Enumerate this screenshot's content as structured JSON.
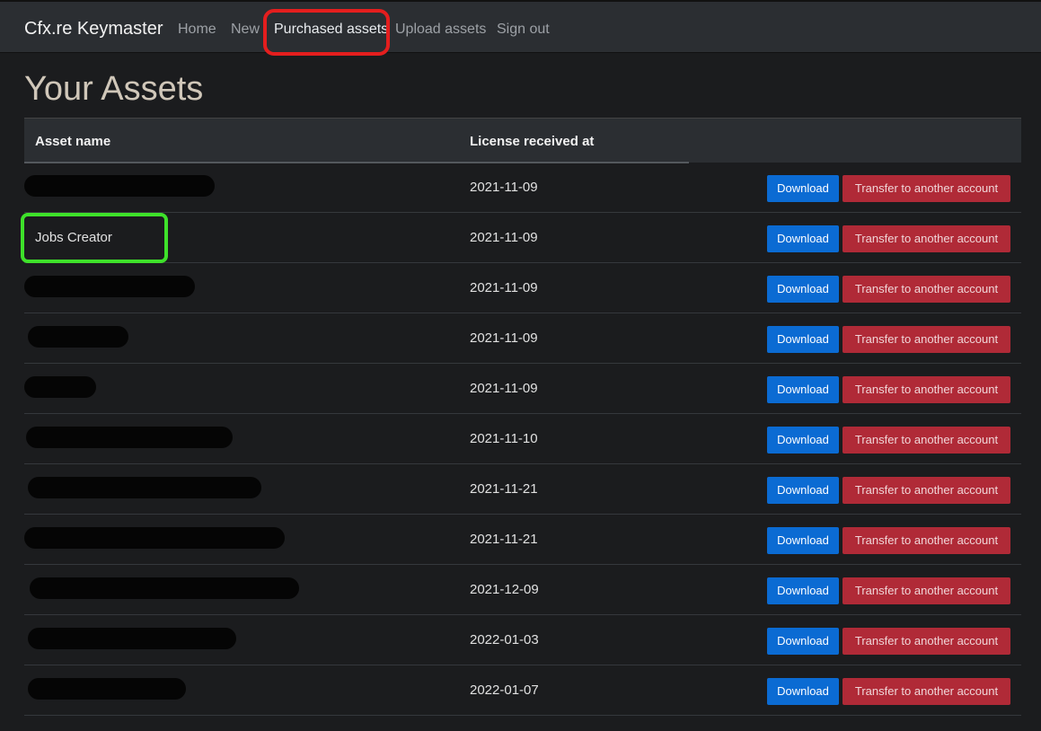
{
  "navbar": {
    "brand": "Cfx.re Keymaster",
    "links": [
      "Home",
      "New",
      "Purchased assets",
      "Upload assets",
      "Sign out"
    ]
  },
  "page": {
    "title": "Your Assets"
  },
  "table": {
    "headers": [
      "Asset name",
      "License received at"
    ],
    "download_label": "Download",
    "transfer_label": "Transfer to another account",
    "rows": [
      {
        "name": "",
        "redacted": true,
        "date": "2021-11-09"
      },
      {
        "name": "Jobs Creator",
        "redacted": false,
        "date": "2021-11-09"
      },
      {
        "name": "",
        "redacted": true,
        "date": "2021-11-09"
      },
      {
        "name": "",
        "redacted": true,
        "date": "2021-11-09"
      },
      {
        "name": "",
        "redacted": true,
        "date": "2021-11-09"
      },
      {
        "name": "",
        "redacted": true,
        "date": "2021-11-10"
      },
      {
        "name": "",
        "redacted": true,
        "date": "2021-11-21"
      },
      {
        "name": "",
        "redacted": true,
        "date": "2021-11-21"
      },
      {
        "name": "",
        "redacted": true,
        "date": "2021-12-09"
      },
      {
        "name": "",
        "redacted": true,
        "date": "2022-01-03"
      },
      {
        "name": "",
        "redacted": true,
        "date": "2022-01-07"
      }
    ]
  },
  "colors": {
    "download": "#0b6bd3",
    "transfer": "#b02a37",
    "highlight_red": "#e41e1e",
    "highlight_green": "#3ee12a"
  }
}
